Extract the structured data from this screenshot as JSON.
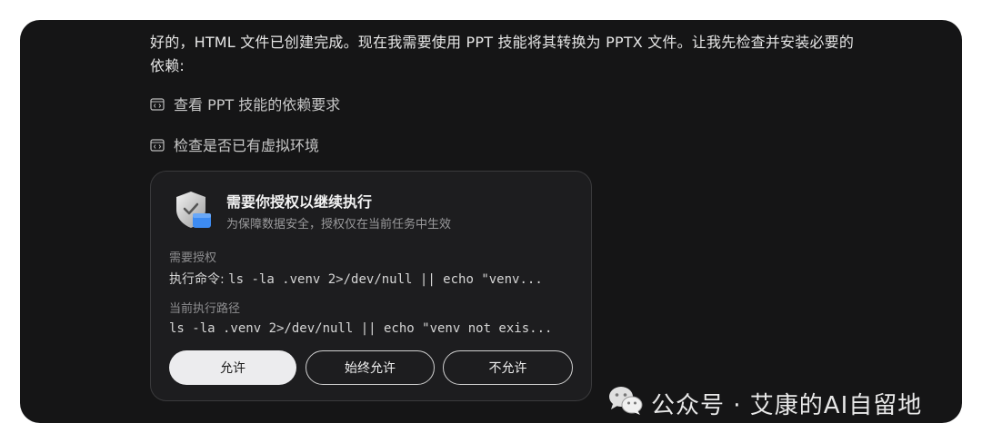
{
  "message": {
    "text": "好的，HTML 文件已创建完成。现在我需要使用 PPT 技能将其转换为 PPTX 文件。让我先检查并安装必要的依赖:"
  },
  "steps": [
    {
      "icon": "code-icon",
      "label": "查看 PPT 技能的依赖要求"
    },
    {
      "icon": "code-icon",
      "label": "检查是否已有虚拟环境"
    }
  ],
  "auth_card": {
    "icon": "shield-check-icon",
    "title": "需要你授权以继续执行",
    "subtitle": "为保障数据安全，授权仅在当前任务中生效",
    "section1_label": "需要授权",
    "command_prefix": "执行命令: ",
    "command": "ls -la .venv 2>/dev/null || echo \"venv...",
    "section2_label": "当前执行路径",
    "path": "ls -la .venv 2>/dev/null || echo \"venv not exis...",
    "buttons": {
      "allow": "允许",
      "always_allow": "始终允许",
      "deny": "不允许"
    }
  },
  "watermark": {
    "icon": "wechat-icon",
    "text": "公众号 · 艾康的AI自留地"
  },
  "colors": {
    "background": "#151516",
    "card": "#1d1d1f",
    "shield_blue": "#3d8bf2"
  }
}
